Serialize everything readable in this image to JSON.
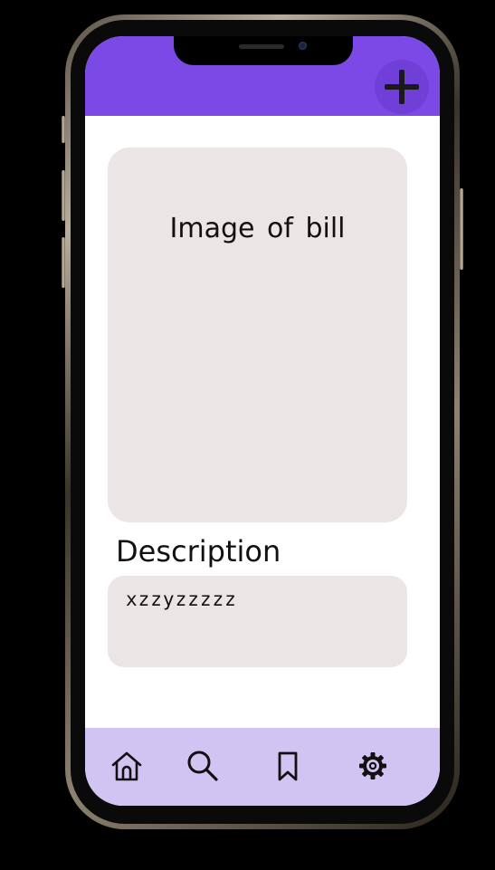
{
  "header": {
    "add_icon": "plus-icon",
    "accent_color": "#7b4ae6"
  },
  "bill": {
    "image_placeholder": "Image  of  bill"
  },
  "description": {
    "label": "Description",
    "value": "xzzyzzzzz"
  },
  "bottom_nav": {
    "background": "#d2c4f2",
    "items": [
      {
        "icon": "home-icon"
      },
      {
        "icon": "search-icon"
      },
      {
        "icon": "bookmark-icon"
      },
      {
        "icon": "settings-icon"
      }
    ]
  }
}
